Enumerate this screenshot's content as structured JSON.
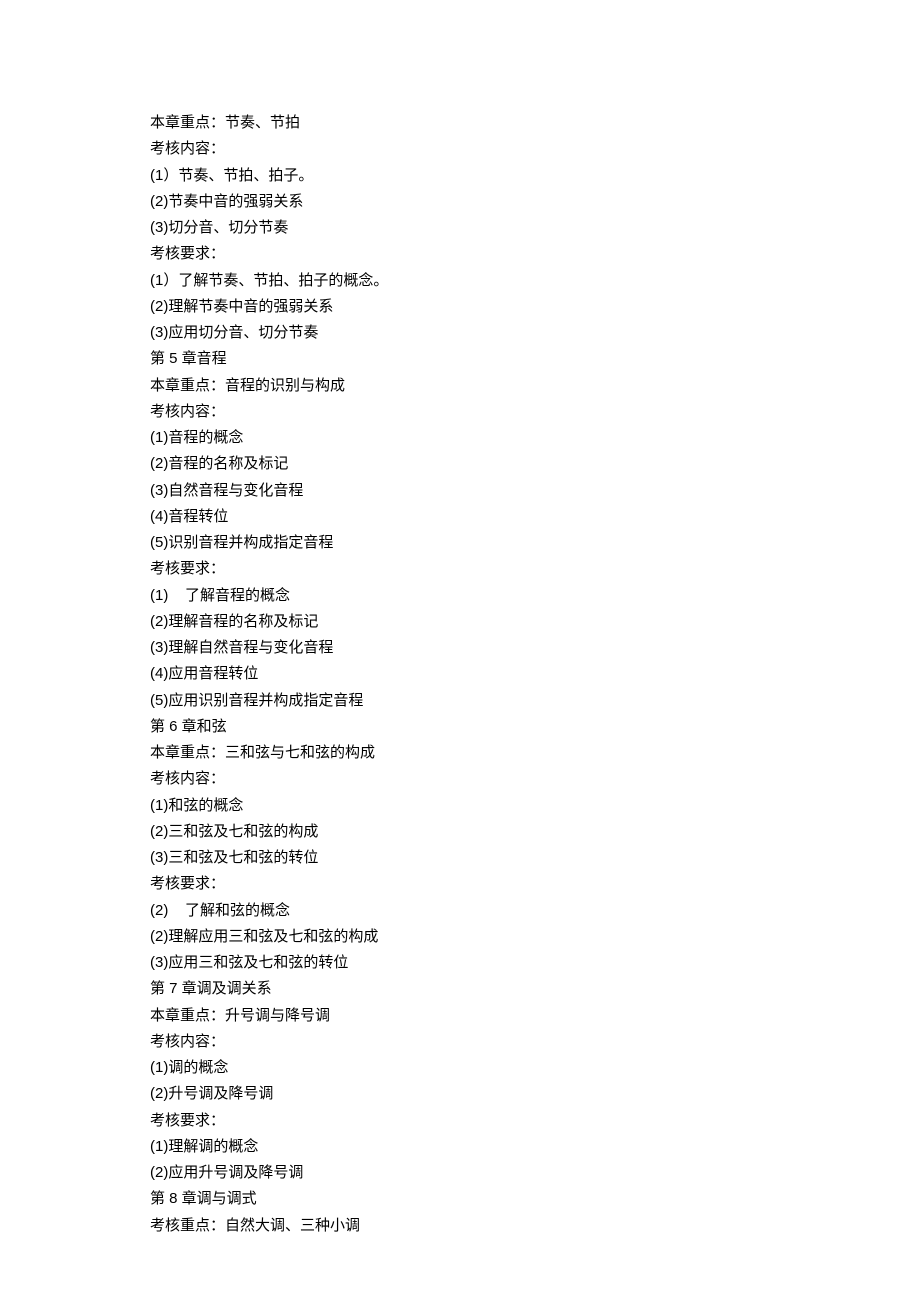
{
  "lines": [
    "本章重点：节奏、节拍",
    "考核内容：",
    "(1）节奏、节拍、拍子。",
    "(2)节奏中音的强弱关系",
    "(3)切分音、切分节奏",
    "考核要求：",
    "(1）了解节奏、节拍、拍子的概念。",
    "(2)理解节奏中音的强弱关系",
    "(3)应用切分音、切分节奏",
    "第 5 章音程",
    "本章重点：音程的识别与构成",
    "考核内容：",
    "(1)音程的概念",
    "(2)音程的名称及标记",
    "(3)自然音程与变化音程",
    "(4)音程转位",
    "(5)识别音程并构成指定音程",
    "考核要求：",
    "(1)    了解音程的概念",
    "(2)理解音程的名称及标记",
    "(3)理解自然音程与变化音程",
    "(4)应用音程转位",
    "(5)应用识别音程并构成指定音程",
    "第 6 章和弦",
    "本章重点：三和弦与七和弦的构成",
    "考核内容：",
    "(1)和弦的概念",
    "(2)三和弦及七和弦的构成",
    "(3)三和弦及七和弦的转位",
    "考核要求：",
    "(2)    了解和弦的概念",
    "(2)理解应用三和弦及七和弦的构成",
    "(3)应用三和弦及七和弦的转位",
    "第 7 章调及调关系",
    "本章重点：升号调与降号调",
    "考核内容：",
    "(1)调的概念",
    "(2)升号调及降号调",
    "考核要求：",
    "(1)理解调的概念",
    "(2)应用升号调及降号调",
    "第 8 章调与调式",
    "考核重点：自然大调、三种小调"
  ]
}
